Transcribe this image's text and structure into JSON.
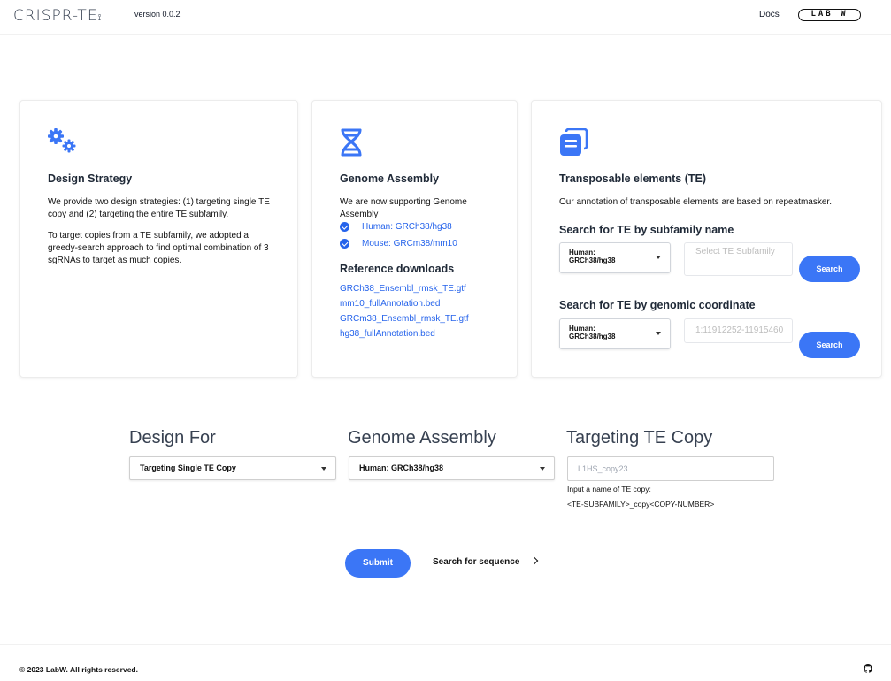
{
  "header": {
    "logo": "CRISPR-TE",
    "version": "version 0.0.2",
    "docs": "Docs",
    "labw_logo": "LAB W"
  },
  "design_strategy": {
    "icon": "gears-icon",
    "title": "Design Strategy",
    "para1": "We provide two design strategies: (1) targeting single TE copy and (2) targeting the entire TE subfamily.",
    "para2": "To target copies from a TE subfamily, we adopted a greedy-search approach to find optimal combination of 3 sgRNAs to target as much copies."
  },
  "genome_assembly": {
    "icon": "dna-icon",
    "title": "Genome Assembly",
    "text": "We are now supporting Genome Assembly",
    "supported": [
      "Human: GRCh38/hg38",
      "Mouse: GRCm38/mm10"
    ],
    "ref_title": "Reference downloads",
    "downloads": [
      "GRCh38_Ensembl_rmsk_TE.gtf",
      "mm10_fullAnnotation.bed",
      "GRCm38_Ensembl_rmsk_TE.gtf",
      "hg38_fullAnnotation.bed"
    ]
  },
  "te": {
    "icon": "copy-icon",
    "title": "Transposable elements (TE)",
    "text": "Our annotation of transposable elements are based on repeatmasker.",
    "subfamily_title": "Search for TE by subfamily name",
    "subfamily_select": "Human: GRCh38/hg38",
    "subfamily_placeholder": "Select TE Subfamily",
    "coord_title": "Search for TE by genomic coordinate",
    "coord_select": "Human: GRCh38/hg38",
    "coord_placeholder": "1:11912252-11915460",
    "search_label": "Search"
  },
  "form": {
    "design_for_label": "Design For",
    "design_for_value": "Targeting Single TE Copy",
    "assembly_label": "Genome Assembly",
    "assembly_value": "Human: GRCh38/hg38",
    "te_copy_label": "Targeting TE Copy",
    "te_copy_placeholder": "L1HS_copy23",
    "hint1": "Input a name of TE copy:",
    "hint2": "<TE-SUBFAMILY>_copy<COPY-NUMBER>",
    "submit": "Submit",
    "search_sequence": "Search for sequence"
  },
  "footer": {
    "copyright": "© 2023 LabW. All rights reserved.",
    "github_icon": "github-icon"
  },
  "colors": {
    "accent": "#3b76f6",
    "link": "#2563eb"
  }
}
